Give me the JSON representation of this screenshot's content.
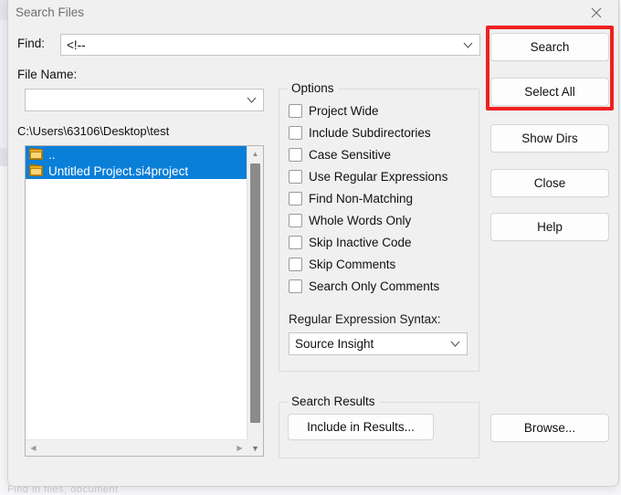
{
  "window": {
    "title": "Search Files",
    "close_icon": "close-icon"
  },
  "background": {
    "bottom_text": "Find in files, document"
  },
  "form": {
    "find_label": "Find:",
    "find_value": "<!--",
    "find_chevron": "chevron-down-icon",
    "filename_label": "File Name:",
    "filename_value": "",
    "filename_placeholder": "",
    "filename_chevron": "chevron-down-icon"
  },
  "file_browser": {
    "path": "C:\\Users\\63106\\Desktop\\test",
    "items": [
      {
        "label": "..",
        "icon": "folder-icon",
        "selected": true
      },
      {
        "label": "Untitled Project.si4project",
        "icon": "folder-icon",
        "selected": true
      }
    ],
    "scroll_up_icon": "triangle-up-icon",
    "scroll_down_icon": "triangle-down-icon",
    "scroll_left_icon": "triangle-left-icon",
    "scroll_right_icon": "triangle-right-icon",
    "corner_icon": "triangle-down-icon"
  },
  "options": {
    "legend": "Options",
    "checkboxes": [
      {
        "label": "Project Wide",
        "checked": false
      },
      {
        "label": "Include Subdirectories",
        "checked": false
      },
      {
        "label": "Case Sensitive",
        "checked": false
      },
      {
        "label": "Use Regular Expressions",
        "checked": false
      },
      {
        "label": "Find Non-Matching",
        "checked": false
      },
      {
        "label": "Whole Words Only",
        "checked": false
      },
      {
        "label": "Skip Inactive Code",
        "checked": false
      },
      {
        "label": "Skip Comments",
        "checked": false
      },
      {
        "label": "Search Only Comments",
        "checked": false
      }
    ],
    "regex_syntax_label": "Regular Expression Syntax:",
    "regex_syntax_value": "Source Insight",
    "regex_syntax_chevron": "chevron-down-icon"
  },
  "search_results": {
    "legend": "Search Results",
    "include_button": "Include in Results..."
  },
  "buttons": {
    "search": "Search",
    "select_all": "Select All",
    "show_dirs": "Show Dirs",
    "close": "Close",
    "help": "Help",
    "browse": "Browse..."
  },
  "annotation": {
    "highlight_color": "#f02020"
  },
  "colors": {
    "dialog_bg": "#f0f0f0",
    "selection_blue": "#0a7fd8",
    "folder_yellow": "#e8a91d",
    "text": "#101010",
    "title_text": "#6f6f73"
  }
}
